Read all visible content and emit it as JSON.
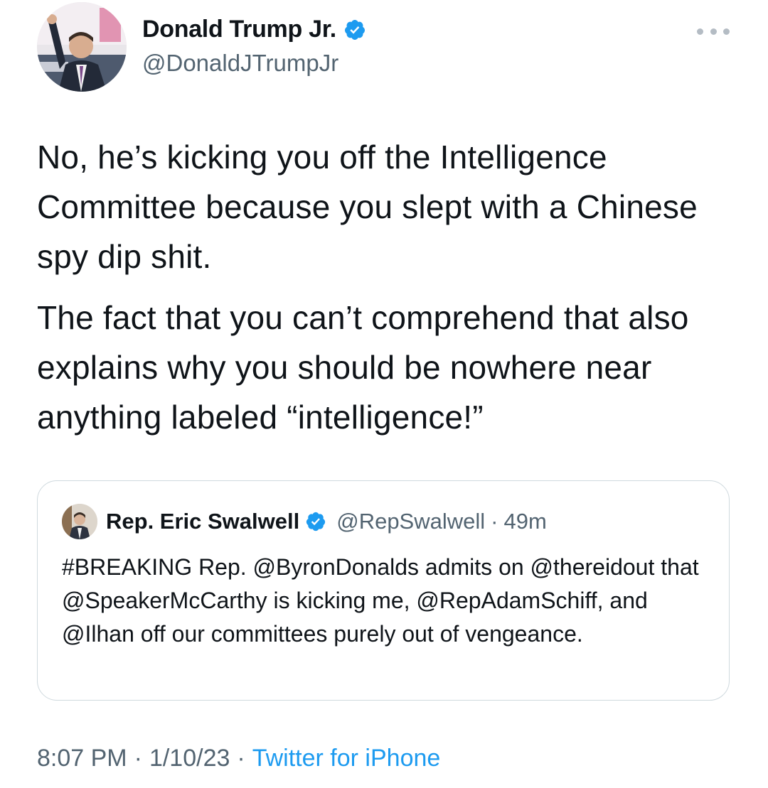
{
  "author": {
    "name": "Donald Trump Jr.",
    "handle": "@DonaldJTrumpJr",
    "avatar_icon": "profile-photo"
  },
  "more_icon": "ellipsis-icon",
  "tweet": {
    "paragraphs": [
      "No, he’s kicking you off the Intelligence Committee because you slept with a Chinese spy dip shit.",
      "The fact that you can’t comprehend that also explains why you should be nowhere near anything labeled “intelligence!”"
    ]
  },
  "quoted_tweet": {
    "name": "Rep. Eric Swalwell",
    "handle": "@RepSwalwell",
    "separator": "·",
    "time": "49m",
    "text": "#BREAKING Rep. @ByronDonalds admits on @thereidout that @SpeakerMcCarthy is kicking me, @RepAdamSchiff, and @Ilhan off our committees purely out of vengeance."
  },
  "footer": {
    "time": "8:07 PM",
    "separator": "·",
    "date": "1/10/23",
    "source": "Twitter for iPhone"
  },
  "colors": {
    "verified_blue": "#1d9bf0",
    "secondary_text": "#536471",
    "link": "#1d9bf0",
    "border": "#cfd9de"
  }
}
